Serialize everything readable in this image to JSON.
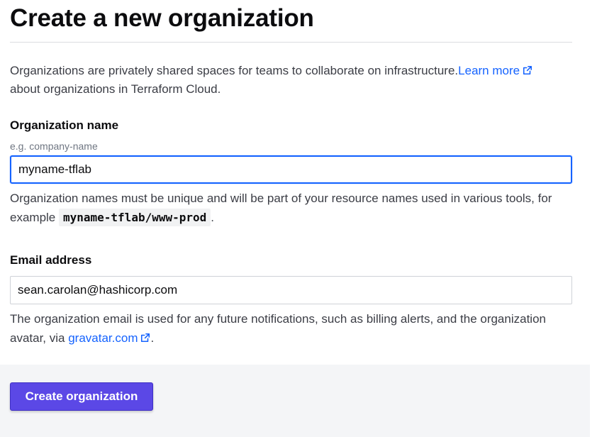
{
  "page": {
    "title": "Create a new organization"
  },
  "intro": {
    "text": "Organizations are privately shared spaces for teams to collaborate on infrastructure.",
    "link_label": "Learn more",
    "text_after": " about organizations in Terraform Cloud."
  },
  "org_name": {
    "label": "Organization name",
    "hint": "e.g. company-name",
    "value": "myname-tflab",
    "help_before": "Organization names must be unique and will be part of your resource names used in various tools, for example ",
    "help_code": "myname-tflab/www-prod",
    "help_after": "."
  },
  "email": {
    "label": "Email address",
    "value": "sean.carolan@hashicorp.com",
    "help_before": "The organization email is used for any future notifications, such as billing alerts, and the organization avatar, via ",
    "help_link": "gravatar.com",
    "help_after": "."
  },
  "actions": {
    "create_label": "Create organization"
  },
  "colors": {
    "link": "#1563ff",
    "primary_button": "#5b48e6",
    "footer_bg": "#f4f5f7"
  },
  "icons": {
    "external_link": "external-link-icon"
  }
}
